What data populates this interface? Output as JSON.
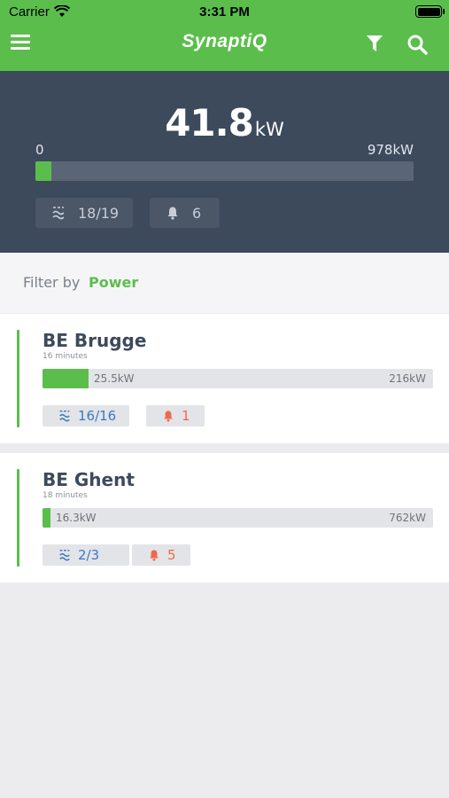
{
  "status_bar": {
    "carrier": "Carrier",
    "time": "3:31 PM"
  },
  "header": {
    "app_name": "SynaptiQ"
  },
  "summary": {
    "total_value": "41.8",
    "total_unit": "kW",
    "range_min": "0",
    "range_max": "978kW",
    "fill_fraction": 0.043,
    "devices": "18/19",
    "alerts": "6"
  },
  "filter": {
    "label": "Filter by",
    "value": "Power"
  },
  "sites": [
    {
      "name": "BE Brugge",
      "age": "16 minutes",
      "current": "25.5kW",
      "max": "216kW",
      "fill_fraction": 0.118,
      "devices": "16/16",
      "alerts": "1"
    },
    {
      "name": "BE Ghent",
      "age": "18 minutes",
      "current": "16.3kW",
      "max": "762kW",
      "fill_fraction": 0.021,
      "devices": "2/3",
      "alerts": "5"
    }
  ],
  "colors": {
    "brand": "#5bbe4c",
    "panel": "#3d4a5c",
    "device": "#3a78c8",
    "alert": "#ec6a4c"
  }
}
